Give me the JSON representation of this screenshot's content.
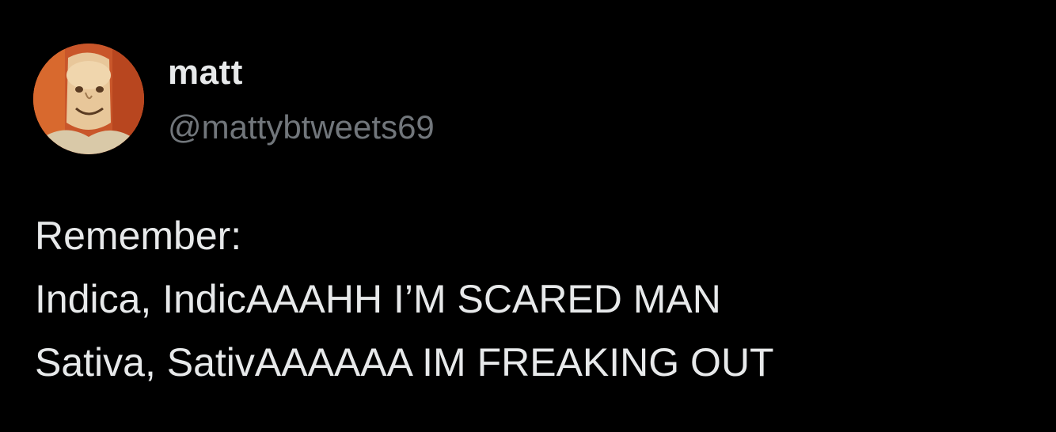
{
  "author": {
    "display_name": "matt",
    "handle": "@mattybtweets69",
    "avatar_icon": "cartoon-face-avatar"
  },
  "tweet": {
    "lines": [
      "Remember:",
      "Indica, IndicAAAHH I’M SCARED MAN",
      "Sativa, SativAAAAAA IM FREAKING OUT"
    ]
  },
  "colors": {
    "background": "#000000",
    "text_primary": "#e7e9ea",
    "text_secondary": "#71767b",
    "avatar_bg": "#c9562a"
  }
}
